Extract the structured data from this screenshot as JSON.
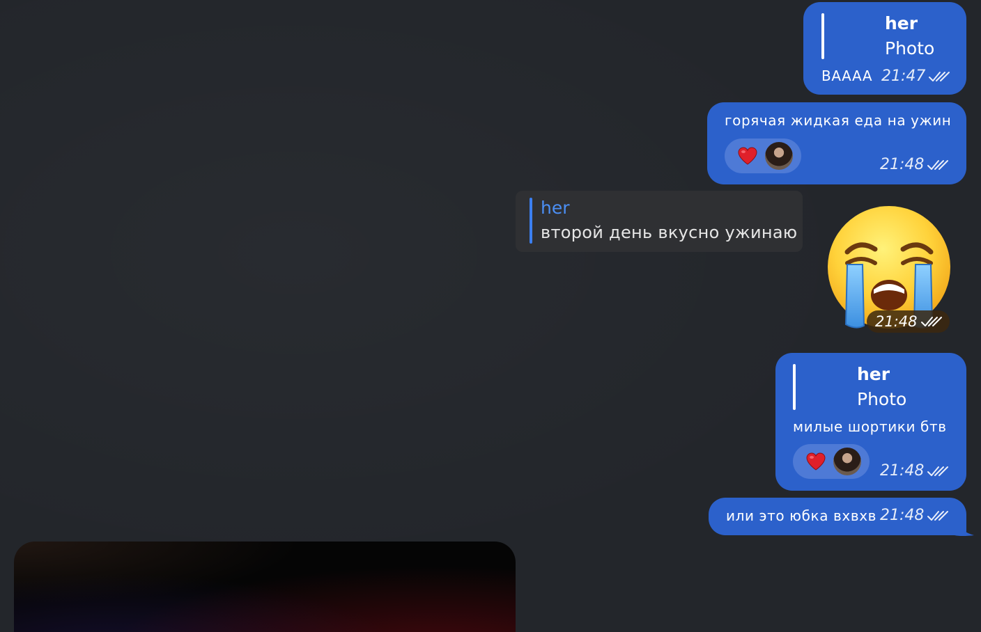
{
  "messages": [
    {
      "reply_to": {
        "name": "her",
        "text": "Photo"
      },
      "text": "BAAAA",
      "time": "21:47"
    },
    {
      "text": "горячая жидкая еда на ужин",
      "reaction": "heart",
      "time": "21:48"
    },
    {
      "incoming_quote": {
        "name": "her",
        "text": "второй день вкусно ужинаю"
      },
      "sticker": "crying-face",
      "time": "21:48"
    },
    {
      "reply_to": {
        "name": "her",
        "text": "Photo"
      },
      "text": "милые шортики бтв",
      "reaction": "heart",
      "time": "21:48"
    },
    {
      "text": "или это юбка вхвхв",
      "time": "21:48"
    }
  ],
  "colors": {
    "background": "#23262b",
    "outgoing_bubble": "#2c61cb",
    "incoming_bubble": "#2f3033",
    "reply_accent": "#3b7ff0"
  }
}
